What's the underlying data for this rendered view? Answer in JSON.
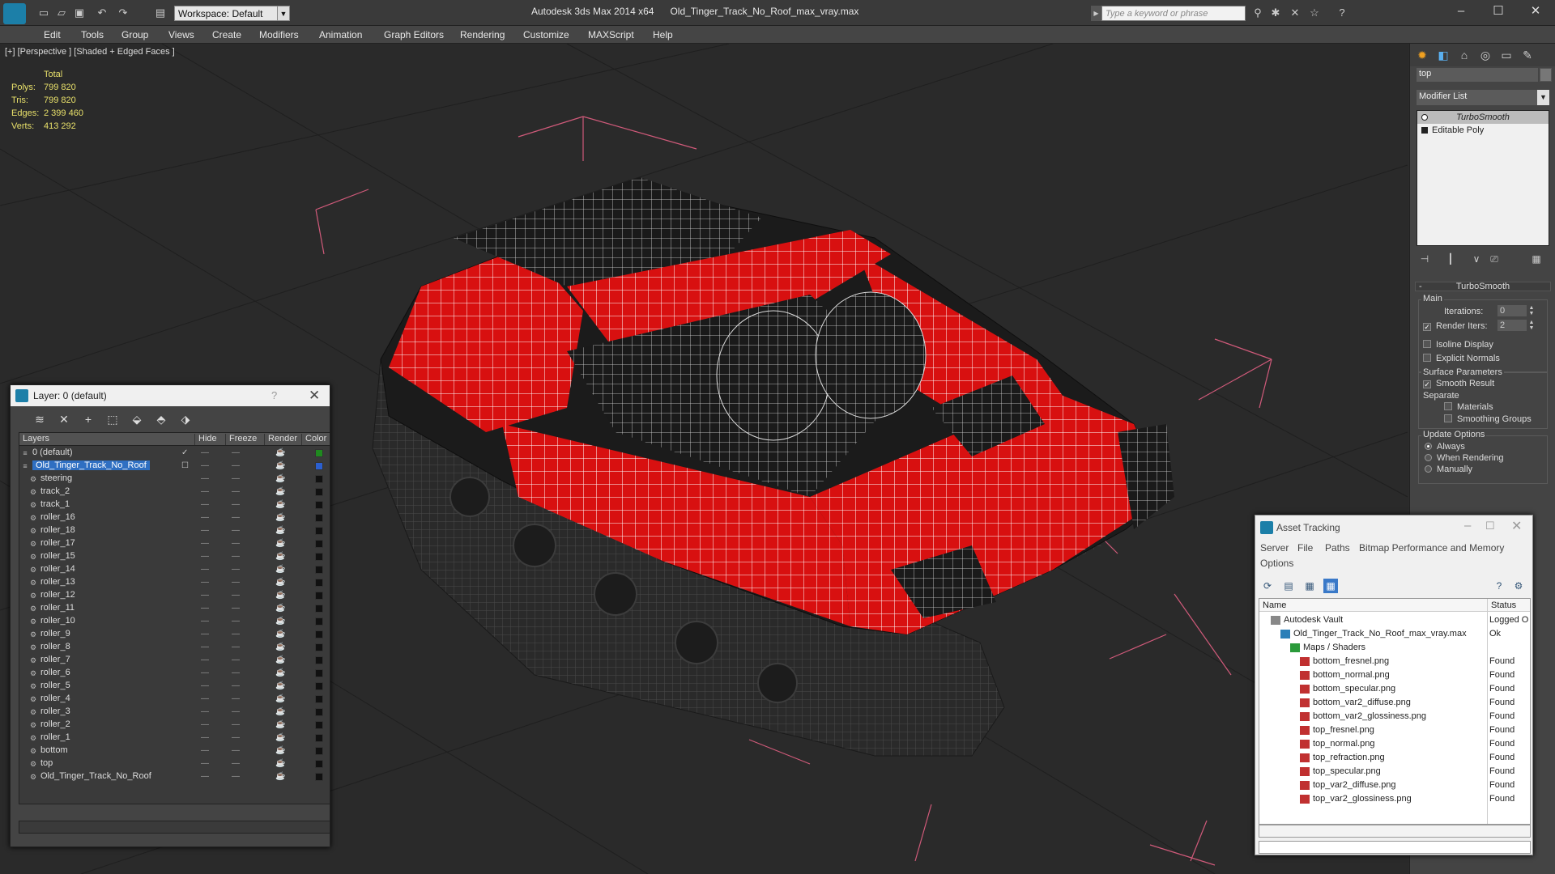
{
  "titlebar": {
    "workspace": "Workspace: Default",
    "app_title": "Autodesk 3ds Max  2014 x64",
    "file_name": "Old_Tinger_Track_No_Roof_max_vray.max",
    "search_placeholder": "Type a keyword or phrase"
  },
  "menu": [
    "Edit",
    "Tools",
    "Group",
    "Views",
    "Create",
    "Modifiers",
    "Animation",
    "Graph Editors",
    "Rendering",
    "Customize",
    "MAXScript",
    "Help"
  ],
  "viewport": {
    "label": "[+] [Perspective ] [Shaded + Edged Faces ]",
    "stats": {
      "header": "Total",
      "polys_label": "Polys:",
      "polys": "799 820",
      "tris_label": "Tris:",
      "tris": "799 820",
      "edges_label": "Edges:",
      "edges": "2 399 460",
      "verts_label": "Verts:",
      "verts": "413 292"
    }
  },
  "command_panel": {
    "object_name": "top",
    "modifier_list": "Modifier List",
    "stack": [
      "TurboSmooth",
      "Editable Poly"
    ],
    "rollout_title": "TurboSmooth",
    "main_group": "Main",
    "iterations_label": "Iterations:",
    "iterations_value": "0",
    "render_iters_label": "Render Iters:",
    "render_iters_value": "2",
    "isoline_label": "Isoline Display",
    "explicit_normals_label": "Explicit Normals",
    "surface_group": "Surface Parameters",
    "smooth_result_label": "Smooth Result",
    "separate_label": "Separate",
    "materials_label": "Materials",
    "smoothing_groups_label": "Smoothing Groups",
    "update_group": "Update Options",
    "always_label": "Always",
    "when_rendering_label": "When Rendering",
    "manually_label": "Manually"
  },
  "layer_dialog": {
    "title": "Layer: 0 (default)",
    "help": "?",
    "columns": {
      "layers": "Layers",
      "hide": "Hide",
      "freeze": "Freeze",
      "render": "Render",
      "color": "Color"
    },
    "layers": [
      {
        "name": "0 (default)",
        "level": 0,
        "color": "#1f8a1f"
      },
      {
        "name": "Old_Tinger_Track_No_Roof",
        "level": 0,
        "color": "#2b5fcf",
        "selected": true
      },
      {
        "name": "steering",
        "level": 1,
        "color": "#111111"
      },
      {
        "name": "track_2",
        "level": 1,
        "color": "#111111"
      },
      {
        "name": "track_1",
        "level": 1,
        "color": "#111111"
      },
      {
        "name": "roller_16",
        "level": 1,
        "color": "#111111"
      },
      {
        "name": "roller_18",
        "level": 1,
        "color": "#111111"
      },
      {
        "name": "roller_17",
        "level": 1,
        "color": "#111111"
      },
      {
        "name": "roller_15",
        "level": 1,
        "color": "#111111"
      },
      {
        "name": "roller_14",
        "level": 1,
        "color": "#111111"
      },
      {
        "name": "roller_13",
        "level": 1,
        "color": "#111111"
      },
      {
        "name": "roller_12",
        "level": 1,
        "color": "#111111"
      },
      {
        "name": "roller_11",
        "level": 1,
        "color": "#111111"
      },
      {
        "name": "roller_10",
        "level": 1,
        "color": "#111111"
      },
      {
        "name": "roller_9",
        "level": 1,
        "color": "#111111"
      },
      {
        "name": "roller_8",
        "level": 1,
        "color": "#111111"
      },
      {
        "name": "roller_7",
        "level": 1,
        "color": "#111111"
      },
      {
        "name": "roller_6",
        "level": 1,
        "color": "#111111"
      },
      {
        "name": "roller_5",
        "level": 1,
        "color": "#111111"
      },
      {
        "name": "roller_4",
        "level": 1,
        "color": "#111111"
      },
      {
        "name": "roller_3",
        "level": 1,
        "color": "#111111"
      },
      {
        "name": "roller_2",
        "level": 1,
        "color": "#111111"
      },
      {
        "name": "roller_1",
        "level": 1,
        "color": "#111111"
      },
      {
        "name": "bottom",
        "level": 1,
        "color": "#111111"
      },
      {
        "name": "top",
        "level": 1,
        "color": "#111111"
      },
      {
        "name": "Old_Tinger_Track_No_Roof",
        "level": 1,
        "color": "#111111"
      }
    ]
  },
  "asset_tracking": {
    "title": "Asset Tracking",
    "menu": [
      "Server",
      "File",
      "Paths",
      "Bitmap Performance and Memory",
      "Options"
    ],
    "col_name": "Name",
    "col_status": "Status",
    "rows": [
      {
        "name": "Autodesk Vault",
        "status": "Logged O",
        "level": 0,
        "icon": "vault"
      },
      {
        "name": "Old_Tinger_Track_No_Roof_max_vray.max",
        "status": "Ok",
        "level": 1,
        "icon": "max"
      },
      {
        "name": "Maps / Shaders",
        "status": "",
        "level": 2,
        "icon": "maps"
      },
      {
        "name": "bottom_fresnel.png",
        "status": "Found",
        "level": 3,
        "icon": "png"
      },
      {
        "name": "bottom_normal.png",
        "status": "Found",
        "level": 3,
        "icon": "png"
      },
      {
        "name": "bottom_specular.png",
        "status": "Found",
        "level": 3,
        "icon": "png"
      },
      {
        "name": "bottom_var2_diffuse.png",
        "status": "Found",
        "level": 3,
        "icon": "png"
      },
      {
        "name": "bottom_var2_glossiness.png",
        "status": "Found",
        "level": 3,
        "icon": "png"
      },
      {
        "name": "top_fresnel.png",
        "status": "Found",
        "level": 3,
        "icon": "png"
      },
      {
        "name": "top_normal.png",
        "status": "Found",
        "level": 3,
        "icon": "png"
      },
      {
        "name": "top_refraction.png",
        "status": "Found",
        "level": 3,
        "icon": "png"
      },
      {
        "name": "top_specular.png",
        "status": "Found",
        "level": 3,
        "icon": "png"
      },
      {
        "name": "top_var2_diffuse.png",
        "status": "Found",
        "level": 3,
        "icon": "png"
      },
      {
        "name": "top_var2_glossiness.png",
        "status": "Found",
        "level": 3,
        "icon": "png"
      }
    ]
  },
  "colors": {
    "accent": "#2f6fc2",
    "model_red": "#e01010",
    "stats_yellow": "#e8e06a",
    "bbox_pink": "#d05a7a"
  }
}
